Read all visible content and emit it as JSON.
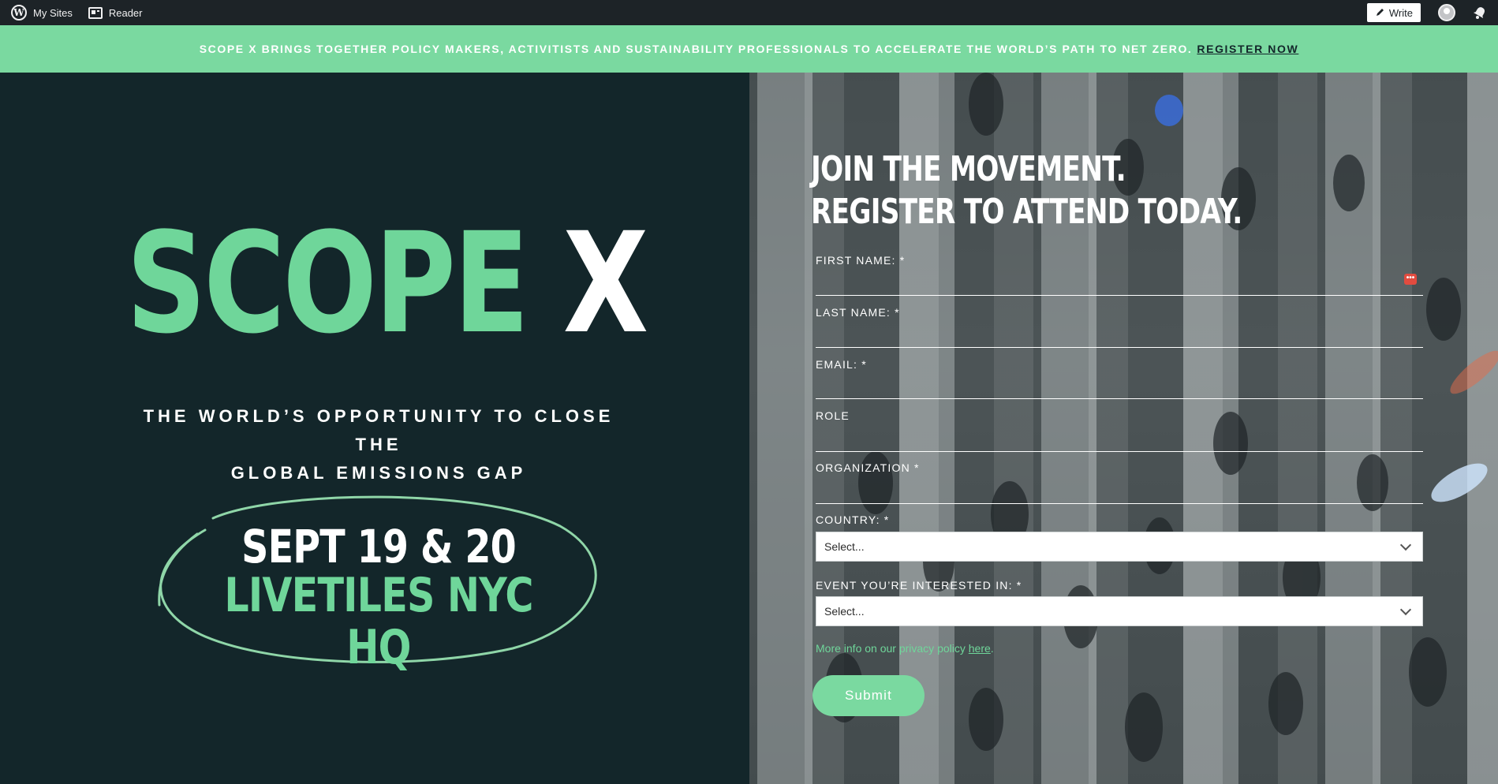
{
  "adminbar": {
    "my_sites": "My Sites",
    "reader": "Reader",
    "write": "Write"
  },
  "banner": {
    "message": "SCOPE X BRINGS TOGETHER POLICY MAKERS, ACTIVITISTS AND SUSTAINABILITY PROFESSIONALS TO ACCELERATE THE WORLD’S PATH TO NET ZERO.",
    "link": "REGISTER NOW"
  },
  "hero": {
    "brand_part1": "SCOPE",
    "brand_part2": "X",
    "tagline_line1": "THE WORLD’S OPPORTUNITY TO CLOSE THE",
    "tagline_line2": "GLOBAL EMISSIONS GAP",
    "date": "SEPT 19 & 20",
    "venue": "LIVETILES NYC HQ"
  },
  "form": {
    "title_line1": "JOIN THE MOVEMENT.",
    "title_line2": "REGISTER TO ATTEND TODAY.",
    "first_name_label": "FIRST NAME: *",
    "last_name_label": "LAST NAME: *",
    "email_label": "EMAIL: *",
    "role_label": "ROLE",
    "organization_label": "ORGANIZATION *",
    "country_label": "COUNTRY: *",
    "country_value": "Select...",
    "event_label": "EVENT YOU’RE INTERESTED IN: *",
    "event_value": "Select...",
    "privacy_text": "More info on our privacy policy ",
    "privacy_link": "here",
    "privacy_end": ".",
    "submit_label": "Submit",
    "password_icon_text": "•••"
  },
  "colors": {
    "accent_green": "#7ad9a0",
    "brand_green": "#6fd69a",
    "dark_bg": "#13262a",
    "adminbar_bg": "#1d2327"
  }
}
